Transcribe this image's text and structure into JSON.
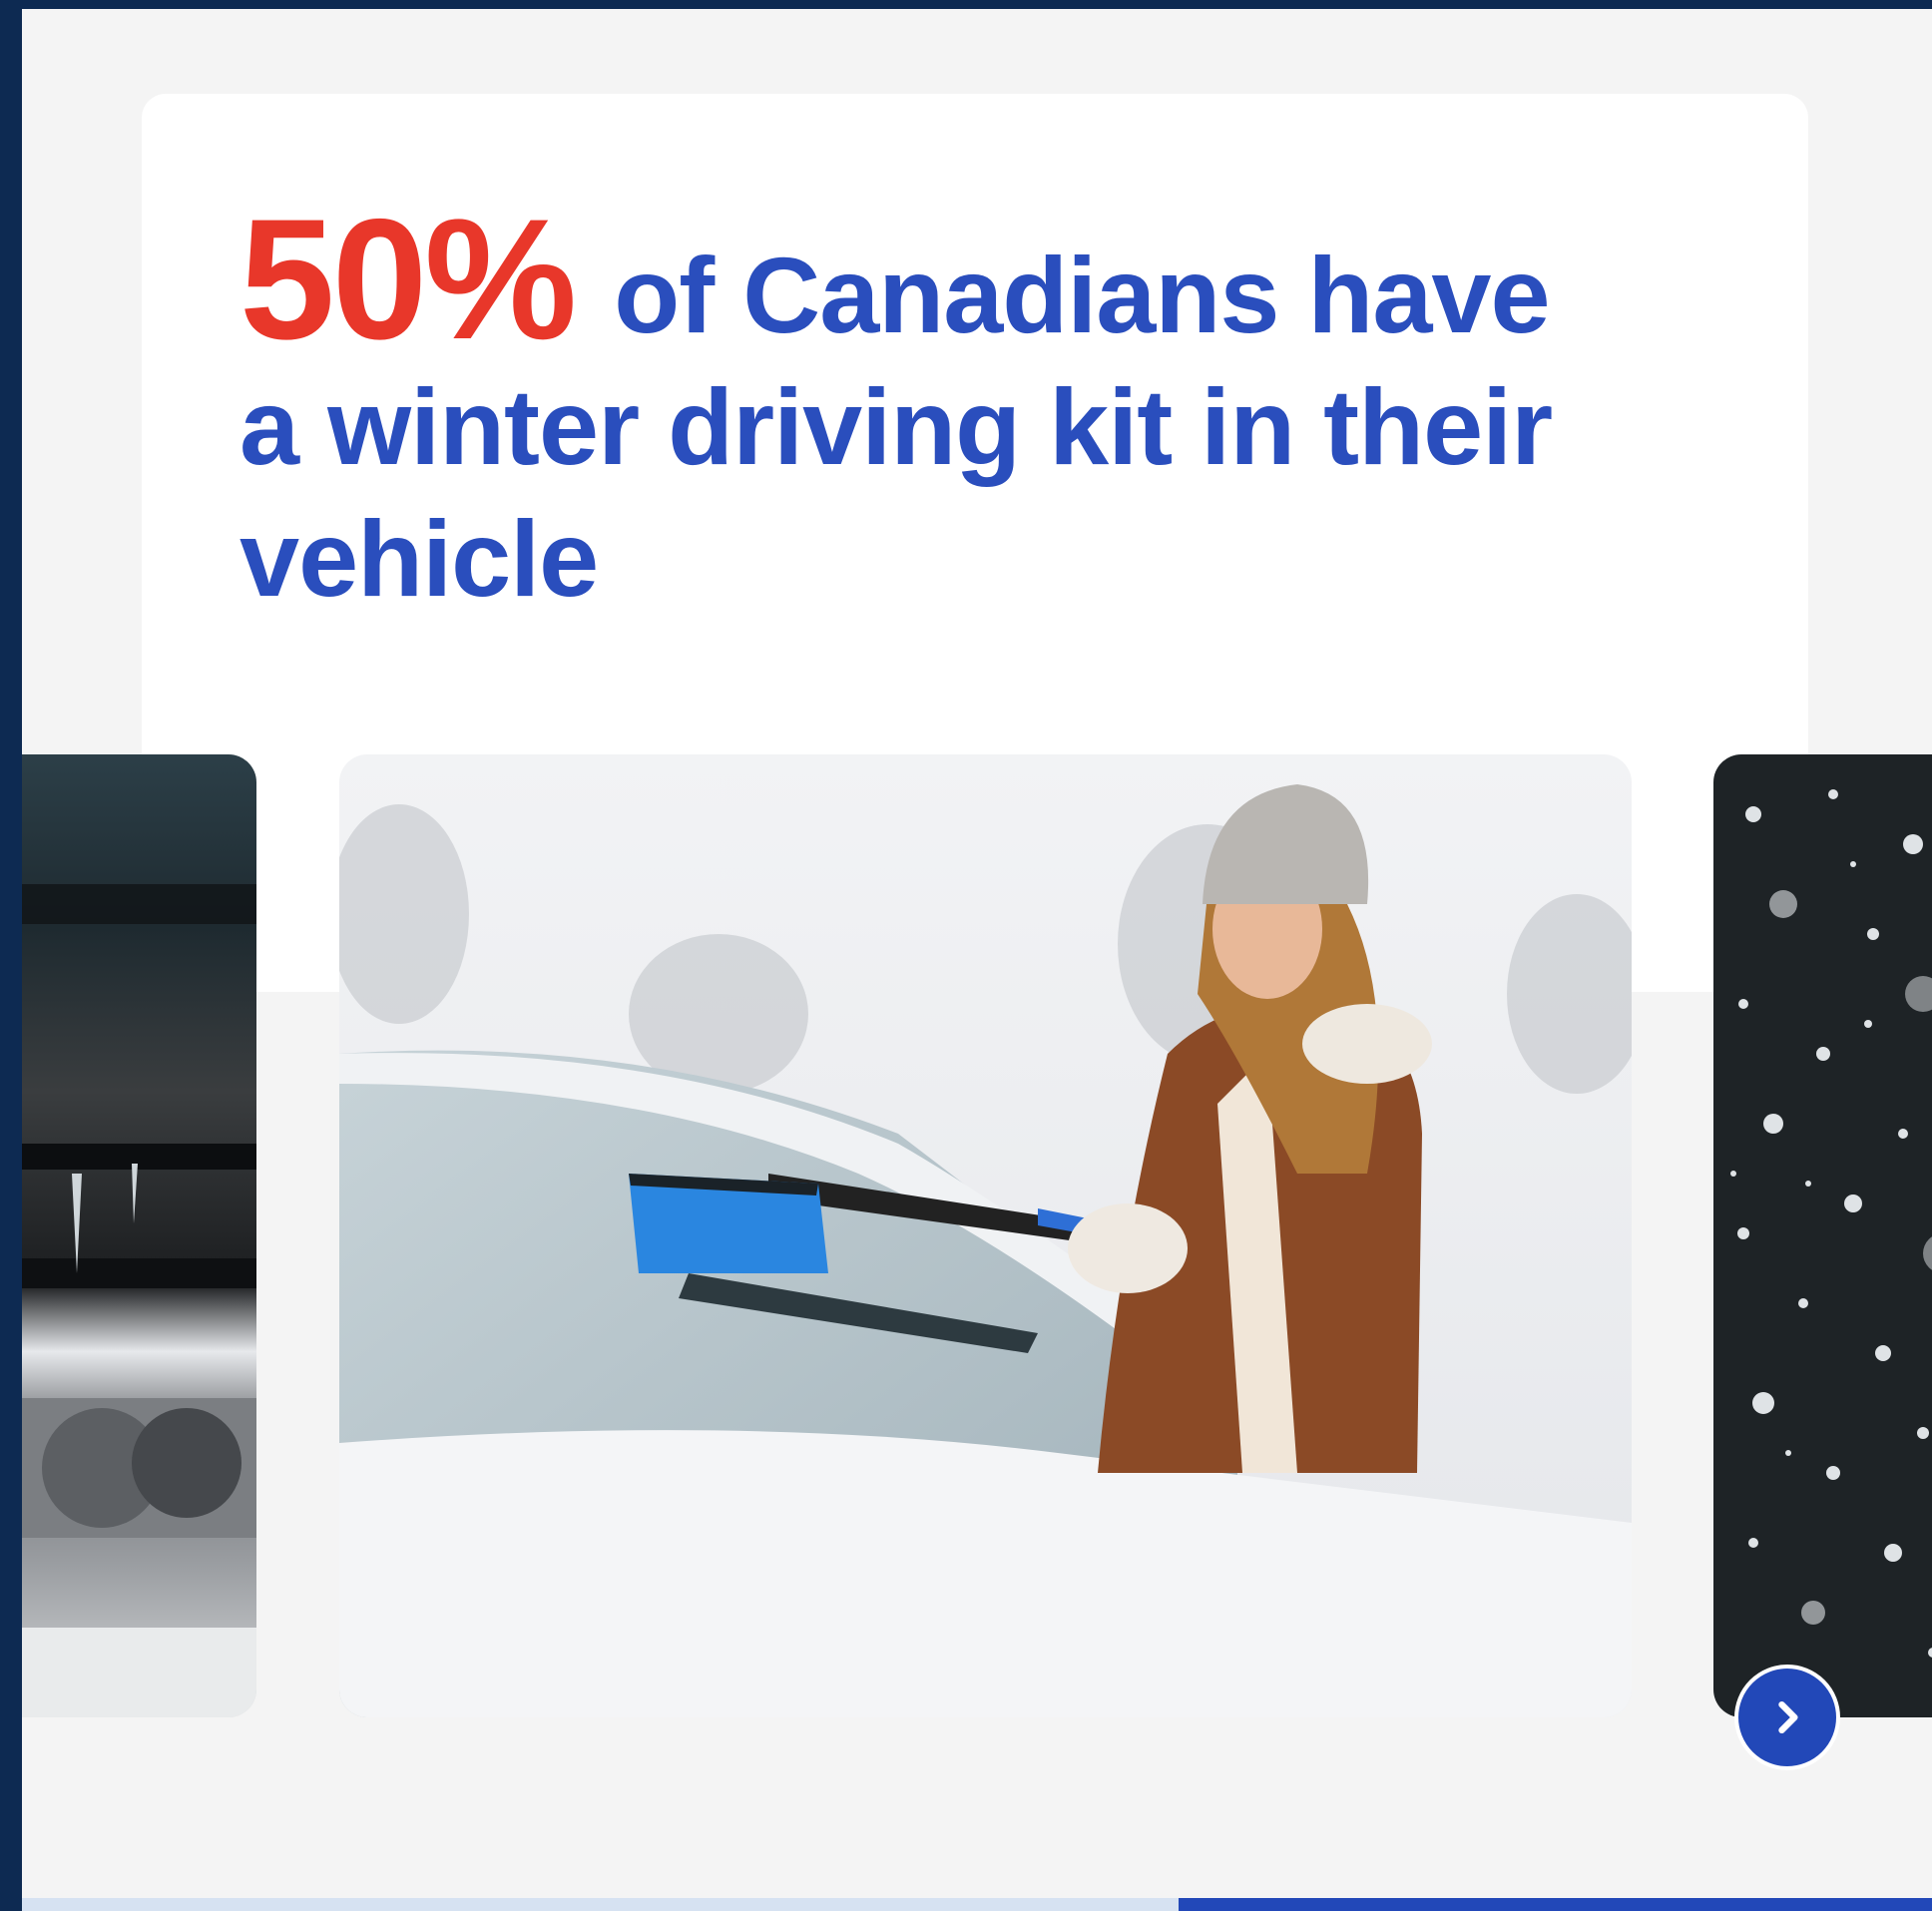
{
  "stat": {
    "percent": "50%",
    "line1_rest": "of Canadians have",
    "line2": "a winter driving kit in their",
    "line3": "vehicle"
  },
  "carousel": {
    "slides": [
      {
        "icon": "frozen-wiper-photo"
      },
      {
        "icon": "woman-brushing-snow-photo"
      },
      {
        "icon": "falling-snow-photo"
      }
    ],
    "next_icon": "chevron-right-icon",
    "progress": 0.39
  },
  "colors": {
    "accent_red": "#e8372a",
    "brand_blue": "#2a4ebd",
    "button_blue": "#2248b8",
    "frame_navy": "#0d2a52"
  }
}
